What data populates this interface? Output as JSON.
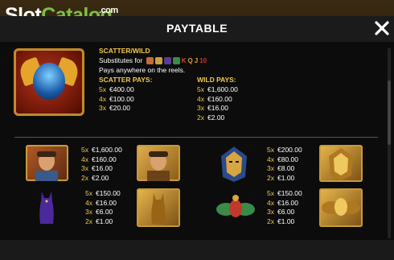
{
  "logo": {
    "word1": "Slot",
    "word2": "Catalog",
    "suffix": ".com"
  },
  "header": {
    "title": "PAYTABLE"
  },
  "scatter": {
    "title": "SCATTER/WILD",
    "substitutes_label": "Substitutes for",
    "substitute_letters": [
      "K",
      "Q",
      "J",
      "10"
    ],
    "anywhere": "Pays anywhere on the reels.",
    "scatter_pays_title": "SCATTER PAYS:",
    "scatter_pays": [
      {
        "k": "5x",
        "v": "€400.00"
      },
      {
        "k": "4x",
        "v": "€100.00"
      },
      {
        "k": "3x",
        "v": "€20.00"
      }
    ],
    "wild_pays_title": "WILD PAYS:",
    "wild_pays": [
      {
        "k": "5x",
        "v": "€1,600.00"
      },
      {
        "k": "4x",
        "v": "€160.00"
      },
      {
        "k": "3x",
        "v": "€16.00"
      },
      {
        "k": "2x",
        "v": "€2.00"
      }
    ]
  },
  "symbols": [
    {
      "name": "explorer",
      "pays": [
        {
          "k": "5x",
          "v": "€1,600.00"
        },
        {
          "k": "4x",
          "v": "€160.00"
        },
        {
          "k": "3x",
          "v": "€16.00"
        },
        {
          "k": "2x",
          "v": "€2.00"
        }
      ]
    },
    {
      "name": "pharaoh",
      "pays": [
        {
          "k": "5x",
          "v": "€200.00"
        },
        {
          "k": "4x",
          "v": "€80.00"
        },
        {
          "k": "3x",
          "v": "€8.00"
        },
        {
          "k": "2x",
          "v": "€1.00"
        }
      ]
    },
    {
      "name": "cat",
      "pays": [
        {
          "k": "5x",
          "v": "€150.00"
        },
        {
          "k": "4x",
          "v": "€16.00"
        },
        {
          "k": "3x",
          "v": "€6.00"
        },
        {
          "k": "2x",
          "v": "€1.00"
        }
      ]
    },
    {
      "name": "scarab",
      "pays": [
        {
          "k": "5x",
          "v": "€150.00"
        },
        {
          "k": "4x",
          "v": "€16.00"
        },
        {
          "k": "3x",
          "v": "€6.00"
        },
        {
          "k": "2x",
          "v": "€1.00"
        }
      ]
    }
  ],
  "icons": {
    "close": "close-icon"
  }
}
